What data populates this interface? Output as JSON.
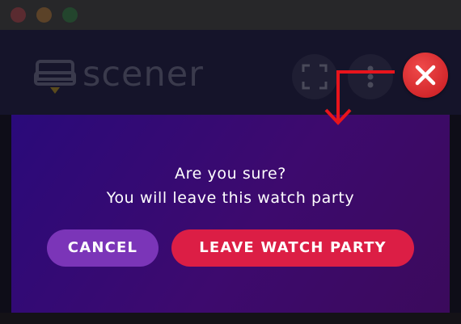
{
  "app": {
    "logo_text": "scener"
  },
  "header": {
    "fullscreen_icon": "fullscreen-icon",
    "more_icon": "more-vertical-icon",
    "close_icon": "close-icon",
    "close_color": "#dc2a2f"
  },
  "dialog": {
    "line1": "Are you sure?",
    "line2": "You will leave this watch party",
    "cancel_label": "CANCEL",
    "leave_label": "LEAVE WATCH PARTY",
    "cancel_color": "#7b35b8",
    "leave_color": "#dc1e45"
  }
}
